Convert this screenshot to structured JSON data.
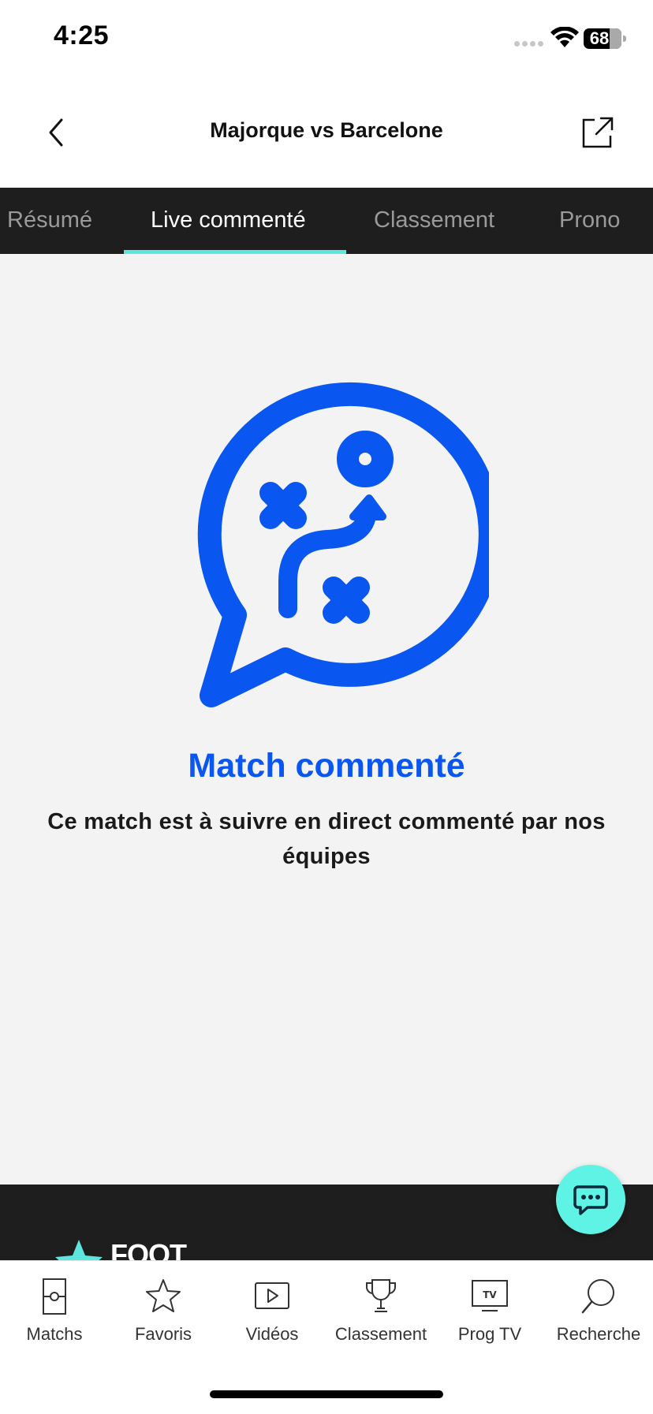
{
  "status_bar": {
    "time": "4:25",
    "battery": "68"
  },
  "header": {
    "title": "Majorque vs Barcelone",
    "back_icon": "chevron-left-icon",
    "share_icon": "share-external-icon"
  },
  "tabs": [
    {
      "label": "Résumé",
      "active": false
    },
    {
      "label": "Live commenté",
      "active": true
    },
    {
      "label": "Classement",
      "active": false
    },
    {
      "label": "Prono",
      "active": false
    }
  ],
  "empty_state": {
    "icon": "tactics-speech-bubble-icon",
    "title": "Match commenté",
    "description": "Ce match est à suivre en direct commenté par nos équipes"
  },
  "footer": {
    "logo_text": "FOOT"
  },
  "chat_button": {
    "icon": "chat-bubble-icon"
  },
  "bottom_nav": [
    {
      "label": "Matchs",
      "icon": "pitch-icon"
    },
    {
      "label": "Favoris",
      "icon": "star-icon"
    },
    {
      "label": "Vidéos",
      "icon": "play-icon"
    },
    {
      "label": "Classement",
      "icon": "trophy-icon"
    },
    {
      "label": "Prog TV",
      "icon": "tv-icon"
    },
    {
      "label": "Recherche",
      "icon": "search-icon"
    }
  ],
  "colors": {
    "accent_blue": "#0a56f0",
    "tab_indicator": "#5de6e0",
    "dark_bar": "#1e1e1e",
    "content_bg": "#f3f3f3"
  }
}
